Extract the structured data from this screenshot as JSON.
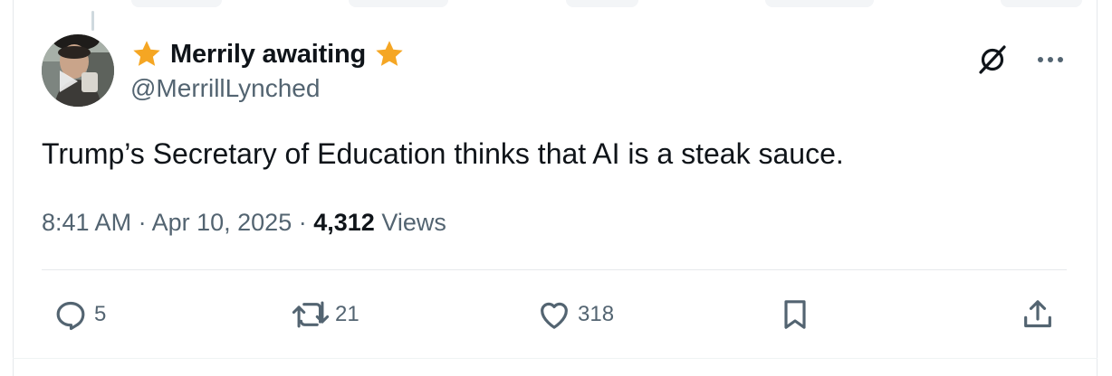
{
  "tweet": {
    "display_name": "Merrily awaiting",
    "handle": "@MerrillLynched",
    "text": "Trump’s Secretary of Education thinks that AI is a steak sauce.",
    "time": "8:41 AM",
    "separator": "·",
    "date": "Apr 10, 2025",
    "views_count": "4,312",
    "views_label": "Views"
  },
  "name_decorations": {
    "left_icon": "star-icon",
    "right_icon": "star-icon",
    "color": "#f5a623"
  },
  "header_actions": {
    "grok_icon": "slashed-circle-icon",
    "more_icon": "more-dots-icon"
  },
  "actions": {
    "replies": "5",
    "reposts": "21",
    "likes": "318"
  },
  "colors": {
    "text_primary": "#0f1419",
    "text_secondary": "#536471",
    "divider": "#e6e9ec"
  }
}
